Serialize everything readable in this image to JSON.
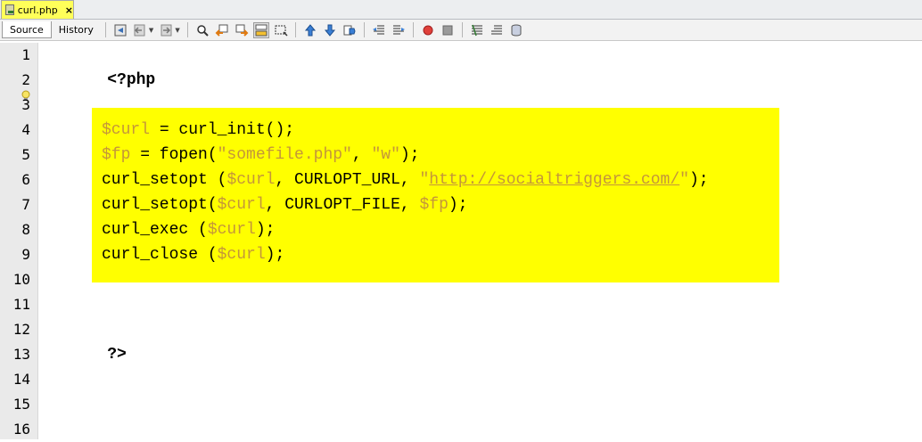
{
  "tab": {
    "title": "curl.php",
    "close": "×"
  },
  "toolbar": {
    "source_label": "Source",
    "history_label": "History"
  },
  "gutter": {
    "lines": [
      "1",
      "2",
      "3",
      "4",
      "5",
      "6",
      "7",
      "8",
      "9",
      "10",
      "11",
      "12",
      "13",
      "14",
      "15",
      "16"
    ]
  },
  "code": {
    "open_tag": "<?php",
    "close_tag": "?>",
    "line4": {
      "var": "$curl",
      "rest": " = curl_init();"
    },
    "line5": {
      "var": "$fp",
      "mid": " = fopen(",
      "str1": "\"somefile.php\"",
      "comma": ", ",
      "str2": "\"w\"",
      "end": ");"
    },
    "line6": {
      "fn": "curl_setopt (",
      "var": "$curl",
      "mid": ", CURLOPT_URL, ",
      "q1": "\"",
      "url": "http://socialtriggers.com/",
      "q2": "\"",
      "end": ");"
    },
    "line7": {
      "fn": "curl_setopt(",
      "var": "$curl",
      "mid": ", CURLOPT_FILE, ",
      "var2": "$fp",
      "end": ");"
    },
    "line8": {
      "fn": "curl_exec (",
      "var": "$curl",
      "end": ");"
    },
    "line9": {
      "fn": "curl_close (",
      "var": "$curl",
      "end": ");"
    }
  },
  "colors": {
    "highlight": "#ffff00",
    "variable": "#c4963a",
    "tab_active": "#ffff59"
  },
  "icons": [
    "php-file-icon",
    "last-edit-icon",
    "back-icon",
    "forward-icon",
    "find-icon",
    "find-previous-icon",
    "find-next-icon",
    "toggle-highlight-icon",
    "toggle-rect-select-icon",
    "previous-bookmark-icon",
    "next-bookmark-icon",
    "toggle-bookmark-icon",
    "shift-left-icon",
    "shift-right-icon",
    "start-macro-icon",
    "stop-macro-icon",
    "comment-icon",
    "uncomment-icon",
    "database-icon"
  ]
}
